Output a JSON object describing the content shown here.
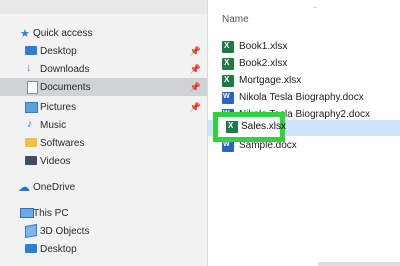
{
  "nav": {
    "items": [
      {
        "label": "Quick access",
        "icon": "star-icon",
        "pinned": false,
        "selected": false
      },
      {
        "label": "Desktop",
        "icon": "desktop-icon",
        "pinned": true,
        "selected": false
      },
      {
        "label": "Downloads",
        "icon": "download-icon",
        "pinned": true,
        "selected": false
      },
      {
        "label": "Documents",
        "icon": "documents-icon",
        "pinned": true,
        "selected": true
      },
      {
        "label": "Pictures",
        "icon": "pictures-icon",
        "pinned": true,
        "selected": false
      },
      {
        "label": "Music",
        "icon": "music-icon",
        "pinned": false,
        "selected": false
      },
      {
        "label": "Softwares",
        "icon": "folder-icon",
        "pinned": false,
        "selected": false
      },
      {
        "label": "Videos",
        "icon": "videos-icon",
        "pinned": false,
        "selected": false
      },
      {
        "label": "OneDrive",
        "icon": "cloud-icon",
        "pinned": false,
        "selected": false
      },
      {
        "label": "This PC",
        "icon": "computer-icon",
        "pinned": false,
        "selected": false
      },
      {
        "label": "3D Objects",
        "icon": "cube-icon",
        "pinned": false,
        "selected": false
      },
      {
        "label": "Desktop",
        "icon": "desktop-icon",
        "pinned": false,
        "selected": false
      }
    ]
  },
  "files": {
    "header": "Name",
    "items": [
      {
        "name": "Book1.xlsx",
        "type": "excel"
      },
      {
        "name": "Book2.xlsx",
        "type": "excel"
      },
      {
        "name": "Mortgage.xlsx",
        "type": "excel"
      },
      {
        "name": "Nikola Tesla Biography.docx",
        "type": "word"
      },
      {
        "name": "Nikola Tesla Biography2.docx",
        "type": "word"
      },
      {
        "name": "Sales.xlsx",
        "type": "excel",
        "highlighted": true
      },
      {
        "name": "Sample.docx",
        "type": "word"
      }
    ]
  },
  "colors": {
    "highlight_border": "#2ed43a",
    "selected_nav": "#cfd3d8"
  }
}
